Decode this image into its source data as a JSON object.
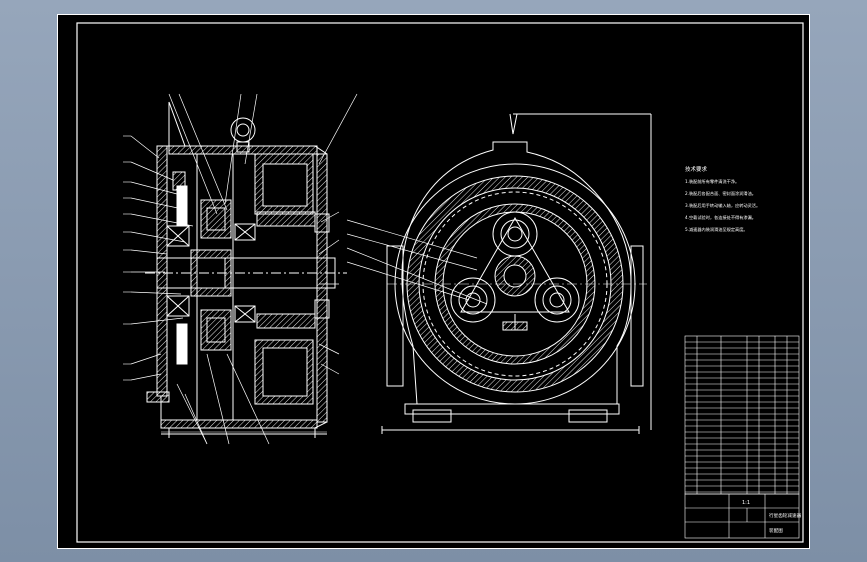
{
  "drawing": {
    "background_color": "#000000",
    "line_color": "#ffffff",
    "accent_color": "#ffff00",
    "frame_color": "#8a9bb1"
  },
  "notes": {
    "heading": "技术要求",
    "lines": [
      "1.装配前所有零件清洗干净。",
      "2.装配后各配合面、密封面涂润滑油。",
      "3.装配后用手转动输入轴，应转动灵活。",
      "4.空载试验时，各连接处不得有渗漏。",
      "5.减速器内装润滑油至规定高度。"
    ]
  },
  "title_block": {
    "scale": "1:1",
    "drawing_name": "行星齿轮减速器",
    "drawing_no": "装配图"
  }
}
